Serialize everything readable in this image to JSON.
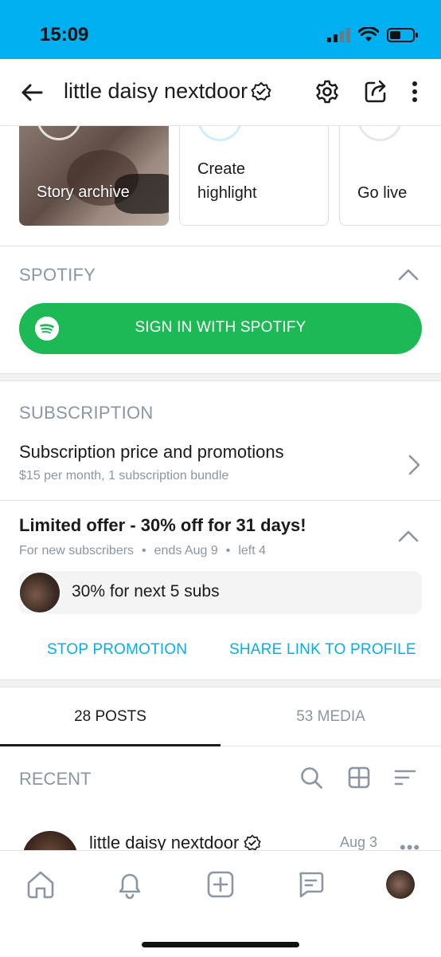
{
  "status_bar": {
    "time": "15:09"
  },
  "header": {
    "title": "little daisy nextdoor"
  },
  "highlights": [
    {
      "label": "Story archive"
    },
    {
      "label": "Create\nhighlight"
    },
    {
      "label": "Go live"
    }
  ],
  "spotify": {
    "heading": "SPOTIFY",
    "button_label": "SIGN IN WITH SPOTIFY"
  },
  "subscription": {
    "heading": "SUBSCRIPTION",
    "title": "Subscription price and promotions",
    "subtitle": "$15 per month, 1 subscription bundle"
  },
  "offer": {
    "title": "Limited offer - 30% off for 31 days!",
    "meta": [
      "For new subscribers",
      "•",
      "ends Aug 9",
      "•",
      "left 4"
    ],
    "pill_text": "30% for next 5 subs",
    "stop_label": "STOP PROMOTION",
    "share_label": "SHARE LINK TO PROFILE"
  },
  "tabs": [
    {
      "label": "28 POSTS",
      "active": true
    },
    {
      "label": "53 MEDIA",
      "active": false
    }
  ],
  "recent": {
    "label": "RECENT"
  },
  "post": {
    "author": "little daisy nextdoor",
    "date": "Aug 3",
    "more": "•••"
  },
  "colors": {
    "brand": "#00aff0",
    "spotify_green": "#1db954",
    "muted": "#8a96a3"
  },
  "icons": [
    "back-arrow-icon",
    "verified-icon",
    "gear-icon",
    "share-icon",
    "kebab-menu-icon",
    "spotify-icon",
    "chevron-up-icon",
    "chevron-right-icon",
    "search-icon",
    "grid-icon",
    "sort-icon",
    "home-icon",
    "bell-icon",
    "add-icon",
    "messages-icon"
  ]
}
